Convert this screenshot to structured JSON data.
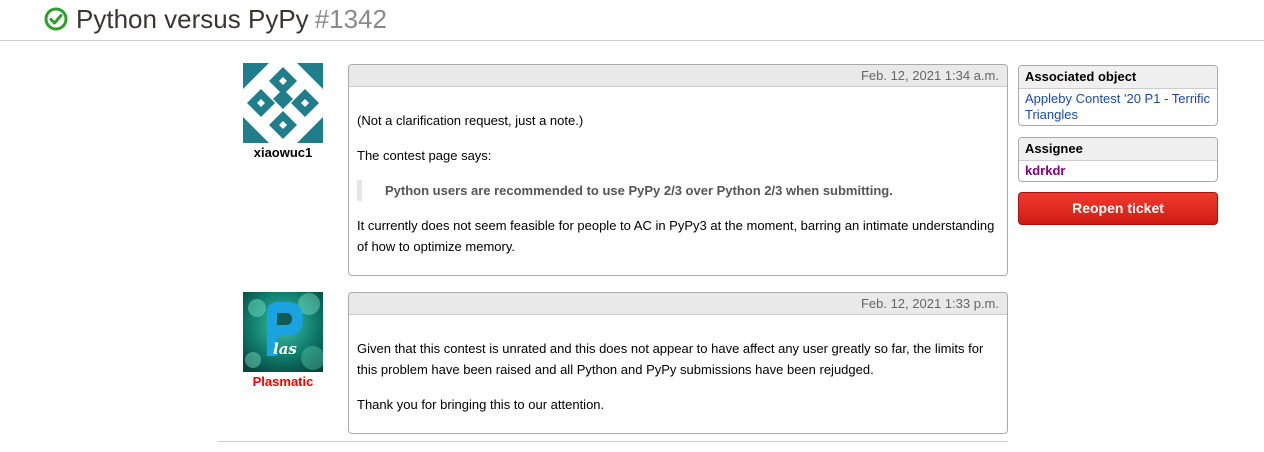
{
  "header": {
    "title": "Python versus PyPy",
    "ticket_number": "#1342",
    "status_icon": "check-circle-icon",
    "status_color": "#2e9e2e"
  },
  "comments": [
    {
      "author": "xiaowuc1",
      "author_color": "#000000",
      "avatar_icon": "geometric-pattern-avatar",
      "timestamp": "Feb. 12, 2021 1:34 a.m.",
      "paragraphs": [
        "(Not a clarification request, just a note.)",
        "The contest page says:"
      ],
      "quote": "Python users are recommended to use PyPy 2/3 over Python 2/3 when submitting.",
      "closing": "It currently does not seem feasible for people to AC in PyPy3 at the moment, barring an intimate understanding of how to optimize memory."
    },
    {
      "author": "Plasmatic",
      "author_color": "#ee0000",
      "avatar_icon": "plasmatic-logo-avatar",
      "timestamp": "Feb. 12, 2021 1:33 p.m.",
      "paragraphs": [
        "Given that this contest is unrated and this does not appear to have affect any user greatly so far, the limits for this problem have been raised and all Python and PyPy submissions have been rejudged.",
        "Thank you for bringing this to our attention."
      ]
    }
  ],
  "sidebar": {
    "associated_object": {
      "label": "Associated object",
      "link": "Appleby Contest '20 P1 - Terrific Triangles"
    },
    "assignee": {
      "label": "Assignee",
      "name": "kdrkdr",
      "name_color": "#800080"
    },
    "reopen_label": "Reopen ticket",
    "reopen_color": "#e0251b"
  }
}
